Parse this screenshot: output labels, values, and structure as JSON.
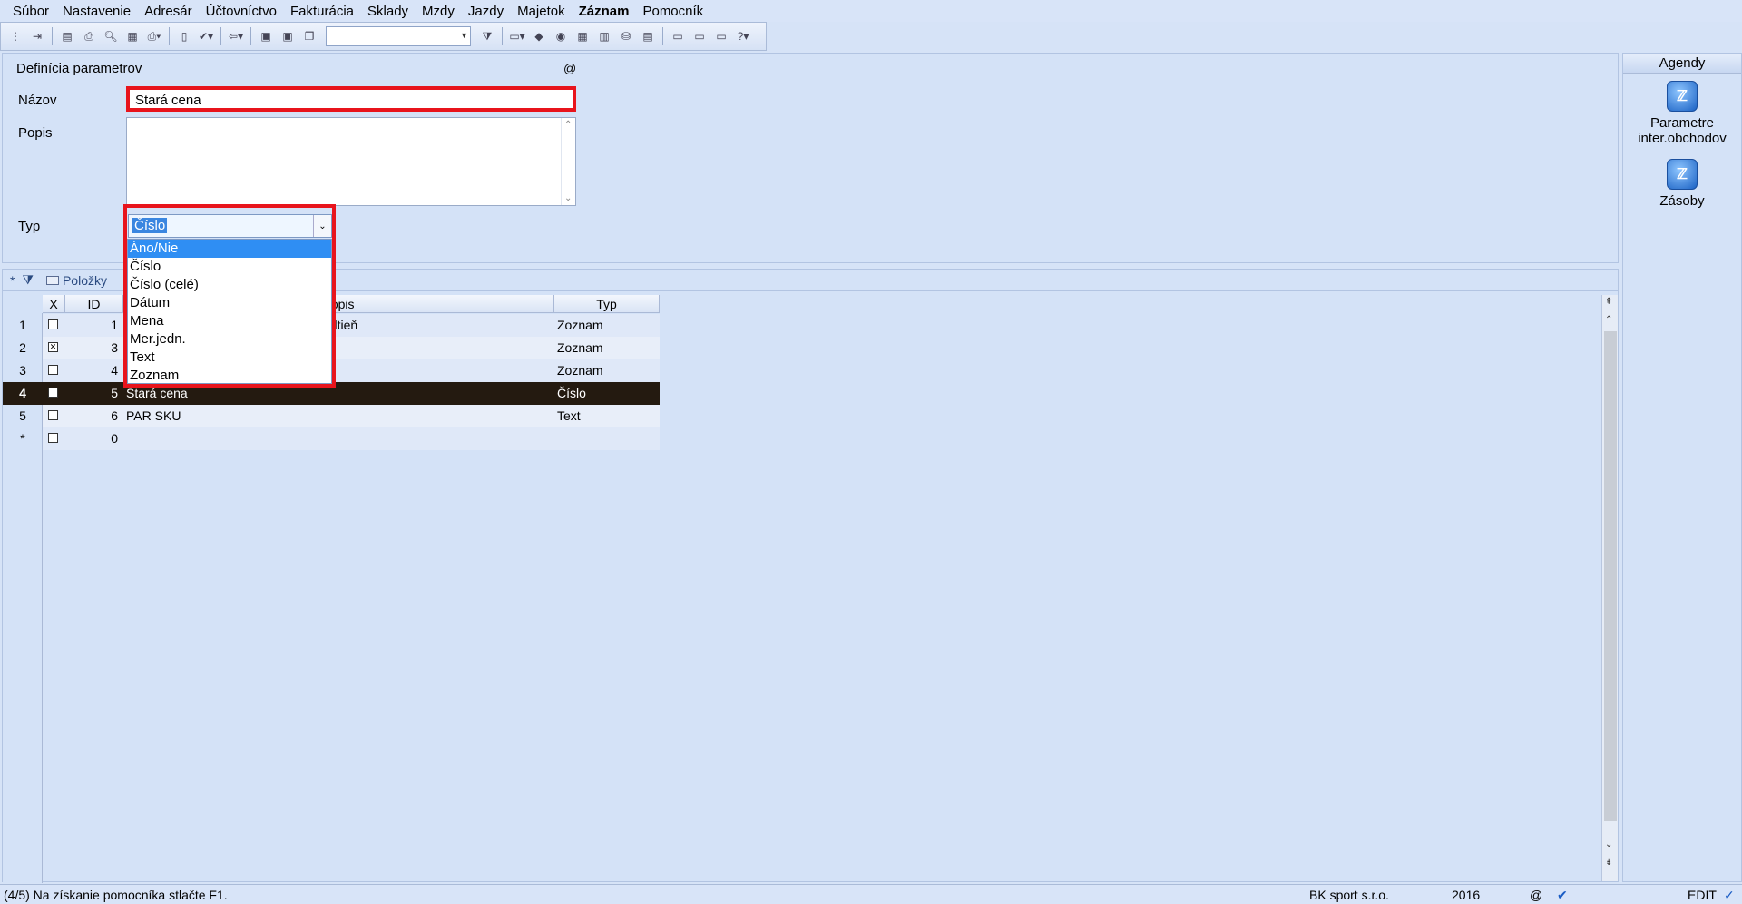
{
  "menu": [
    "Súbor",
    "Nastavenie",
    "Adresár",
    "Účtovníctvo",
    "Fakturácia",
    "Sklady",
    "Mzdy",
    "Jazdy",
    "Majetok",
    "Záznam",
    "Pomocník"
  ],
  "menu_bold_index": 9,
  "form": {
    "title": "Definícia parametrov",
    "at_symbol": "@",
    "nazov_label": "Názov",
    "nazov_value": "Stará cena",
    "popis_label": "Popis",
    "popis_value": "",
    "typ_label": "Typ",
    "typ_value": "Číslo",
    "typ_options": [
      "Áno/Nie",
      "Číslo",
      "Číslo (celé)",
      "Dátum",
      "Mena",
      "Mer.jedn.",
      "Text",
      "Zoznam"
    ],
    "typ_highlighted": "Áno/Nie"
  },
  "grid": {
    "tab_star": "*",
    "tab_label": "Položky",
    "columns": [
      "X",
      "ID",
      "Popis",
      "Typ"
    ],
    "rows": [
      {
        "num": "1",
        "checked": false,
        "id": "1",
        "name": "",
        "popis": "odtieň",
        "typ": "Zoznam"
      },
      {
        "num": "2",
        "checked": true,
        "id": "3",
        "name": "",
        "popis": "",
        "typ": "Zoznam"
      },
      {
        "num": "3",
        "checked": false,
        "id": "4",
        "name": "",
        "popis": "",
        "typ": "Zoznam"
      },
      {
        "num": "4",
        "checked": false,
        "id": "5",
        "name": "Stará cena",
        "popis": "",
        "typ": "Číslo"
      },
      {
        "num": "5",
        "checked": false,
        "id": "6",
        "name": "PAR SKU",
        "popis": "",
        "typ": "Text"
      },
      {
        "num": "*",
        "checked": false,
        "id": "0",
        "name": "",
        "popis": "",
        "typ": ""
      }
    ],
    "selected_row": 3
  },
  "agendy": {
    "title": "Agendy",
    "items": [
      {
        "label": "Parametre inter.obchodov",
        "line1": "Parametre",
        "line2": "inter.obchodov"
      },
      {
        "label": "Zásoby",
        "line1": "Zásoby",
        "line2": ""
      }
    ]
  },
  "status": {
    "left": "(4/5) Na získanie pomocníka stlačte F1.",
    "company": "BK sport  s.r.o.",
    "year": "2016",
    "at": "@",
    "mode": "EDIT"
  },
  "colors": {
    "highlight_red": "#e8141c",
    "selected_row_bg": "#241a10",
    "list_selection": "#2f8ef3"
  }
}
